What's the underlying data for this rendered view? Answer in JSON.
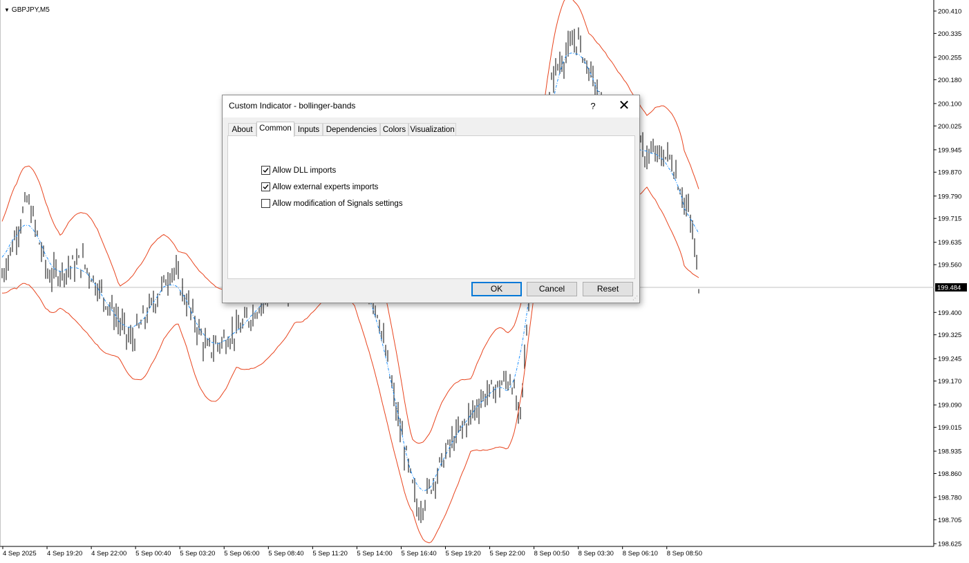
{
  "chart": {
    "symbol": "GBPJPY,M5",
    "current_price": "199.484",
    "price_labels": [
      "200.410",
      "200.335",
      "200.255",
      "200.180",
      "200.100",
      "200.025",
      "199.945",
      "199.870",
      "199.790",
      "199.715",
      "199.635",
      "199.560",
      "199.484",
      "199.400",
      "199.325",
      "199.245",
      "199.170",
      "199.090",
      "199.015",
      "198.935",
      "198.860",
      "198.780",
      "198.705",
      "198.625"
    ],
    "time_labels": [
      "4 Sep 2025",
      "4 Sep 19:20",
      "4 Sep 22:00",
      "5 Sep 00:40",
      "5 Sep 03:20",
      "5 Sep 06:00",
      "5 Sep 08:40",
      "5 Sep 11:20",
      "5 Sep 14:00",
      "5 Sep 16:40",
      "5 Sep 19:20",
      "5 Sep 22:00",
      "8 Sep 00:50",
      "8 Sep 03:30",
      "8 Sep 06:10",
      "8 Sep 08:50"
    ],
    "colors": {
      "bars": "#000000",
      "bands": "#e8431c",
      "middle_line": "#1e90ff",
      "axis": "#000000",
      "price_line": "#c0c0c0"
    }
  },
  "dialog": {
    "title": "Custom Indicator - bollinger-bands",
    "help_label": "?",
    "close_label": "✕",
    "tabs": [
      {
        "label": "About",
        "active": false
      },
      {
        "label": "Common",
        "active": true
      },
      {
        "label": "Inputs",
        "active": false
      },
      {
        "label": "Dependencies",
        "active": false
      },
      {
        "label": "Colors",
        "active": false
      },
      {
        "label": "Visualization",
        "active": false
      }
    ],
    "checkboxes": [
      {
        "label": "Allow DLL imports",
        "checked": true
      },
      {
        "label": "Allow external experts imports",
        "checked": true
      },
      {
        "label": "Allow modification of Signals settings",
        "checked": false
      }
    ],
    "buttons": {
      "ok": "OK",
      "cancel": "Cancel",
      "reset": "Reset"
    }
  }
}
